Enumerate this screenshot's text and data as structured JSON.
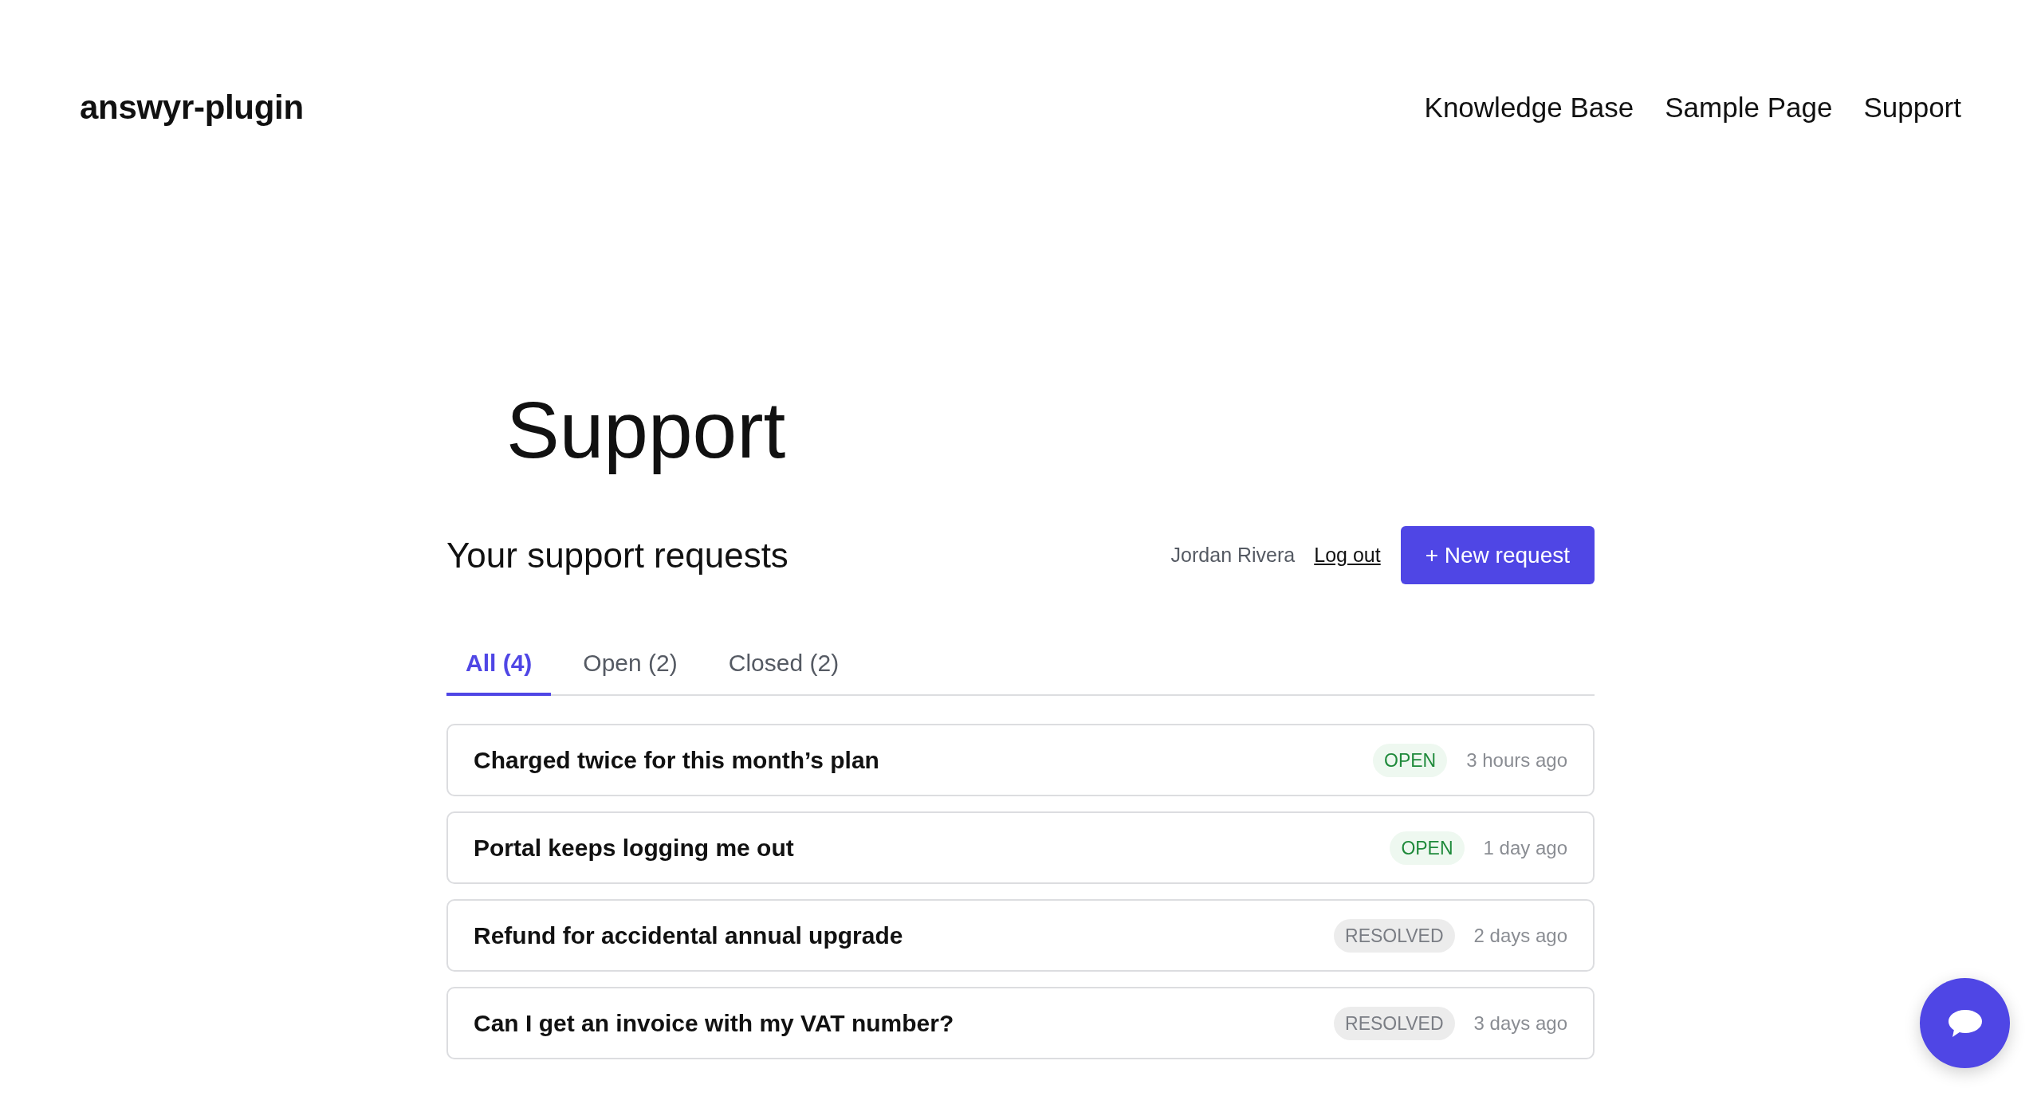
{
  "site_header": {
    "logo": "answyr-plugin",
    "nav": [
      {
        "label": "Knowledge Base"
      },
      {
        "label": "Sample Page"
      },
      {
        "label": "Support"
      }
    ]
  },
  "page": {
    "title": "Support"
  },
  "requests_header": {
    "title": "Your support requests",
    "user_name": "Jordan Rivera",
    "logout": "Log out",
    "new_request_button": "+ New request"
  },
  "tabs": [
    {
      "label": "All (4)",
      "selected": true
    },
    {
      "label": "Open (2)",
      "selected": false
    },
    {
      "label": "Closed (2)",
      "selected": false
    }
  ],
  "requests": [
    {
      "title": "Charged twice for this month’s plan",
      "status": {
        "label": "OPEN",
        "kind": "open"
      },
      "time": "3 hours ago"
    },
    {
      "title": "Portal keeps logging me out",
      "status": {
        "label": "OPEN",
        "kind": "open"
      },
      "time": "1 day ago"
    },
    {
      "title": "Refund for accidental annual upgrade",
      "status": {
        "label": "RESOLVED",
        "kind": "resolved"
      },
      "time": "2 days ago"
    },
    {
      "title": "Can I get an invoice with my VAT number?",
      "status": {
        "label": "RESOLVED",
        "kind": "resolved"
      },
      "time": "3 days ago"
    }
  ]
}
